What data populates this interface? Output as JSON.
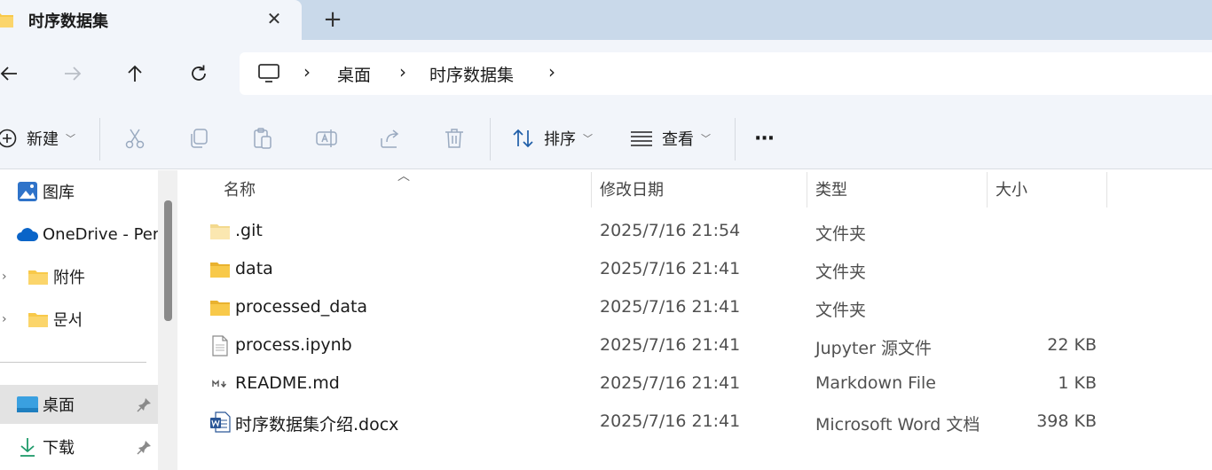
{
  "tab": {
    "title": "时序数据集",
    "close": "✕",
    "new": "+"
  },
  "address": {
    "crumbs": [
      "桌面",
      "时序数据集"
    ],
    "sep": "›"
  },
  "toolbar": {
    "new_label": "新建",
    "sort_label": "排序",
    "view_label": "查看",
    "more_label": "···"
  },
  "sidebar": {
    "items": [
      {
        "label": "图库"
      },
      {
        "label": "OneDrive - Per"
      },
      {
        "label": "附件"
      },
      {
        "label": "문서"
      },
      {
        "label": "桌面"
      },
      {
        "label": "下载"
      }
    ]
  },
  "columns": {
    "name": "名称",
    "modified": "修改日期",
    "type": "类型",
    "size": "大小"
  },
  "files": [
    {
      "name": ".git",
      "modified": "2025/7/16 21:54",
      "type": "文件夹",
      "size": "",
      "icon": "folder-light-icon"
    },
    {
      "name": "data",
      "modified": "2025/7/16 21:41",
      "type": "文件夹",
      "size": "",
      "icon": "folder-icon"
    },
    {
      "name": "processed_data",
      "modified": "2025/7/16 21:41",
      "type": "文件夹",
      "size": "",
      "icon": "folder-icon"
    },
    {
      "name": "process.ipynb",
      "modified": "2025/7/16 21:41",
      "type": "Jupyter 源文件",
      "size": "22 KB",
      "icon": "document-icon"
    },
    {
      "name": "README.md",
      "modified": "2025/7/16 21:41",
      "type": "Markdown File",
      "size": "1 KB",
      "icon": "markdown-icon"
    },
    {
      "name": "时序数据集介绍.docx",
      "modified": "2025/7/16 21:41",
      "type": "Microsoft Word 文档",
      "size": "398 KB",
      "icon": "word-icon"
    }
  ],
  "colors": {
    "accent": "#0067c0",
    "folder": "#f8c94a",
    "chrome": "#f2f5fa",
    "tabstrip": "#c9d9ea"
  }
}
